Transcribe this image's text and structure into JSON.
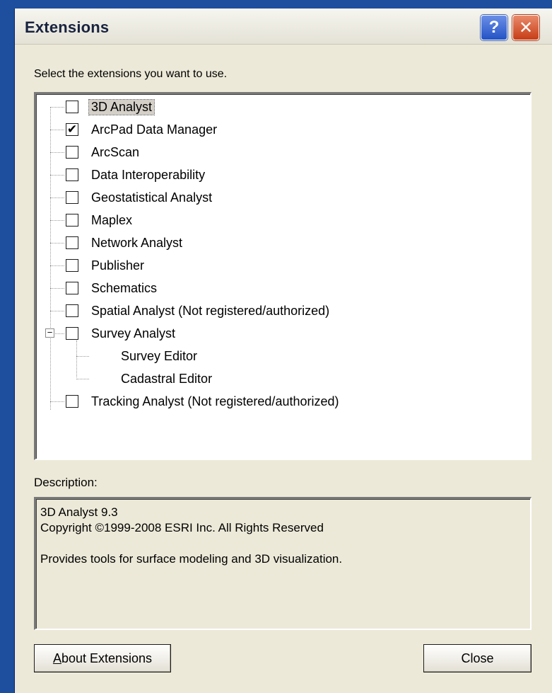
{
  "window": {
    "title": "Extensions",
    "help_glyph": "?",
    "close_glyph": "✕"
  },
  "prompt": "Select the extensions you want to use.",
  "extensions": [
    {
      "label": "3D Analyst",
      "checked": false,
      "selected": true
    },
    {
      "label": "ArcPad Data Manager",
      "checked": true
    },
    {
      "label": "ArcScan",
      "checked": false
    },
    {
      "label": "Data Interoperability",
      "checked": false
    },
    {
      "label": "Geostatistical Analyst",
      "checked": false
    },
    {
      "label": "Maplex",
      "checked": false
    },
    {
      "label": "Network Analyst",
      "checked": false
    },
    {
      "label": "Publisher",
      "checked": false
    },
    {
      "label": "Schematics",
      "checked": false
    },
    {
      "label": "Spatial Analyst (Not registered/authorized)",
      "checked": false
    },
    {
      "label": "Survey Analyst",
      "checked": false,
      "expanded": true,
      "children": [
        "Survey Editor",
        "Cadastral Editor"
      ]
    },
    {
      "label": "Tracking Analyst (Not registered/authorized)",
      "checked": false
    }
  ],
  "description": {
    "label": "Description:",
    "line1": "3D Analyst 9.3",
    "line2": "Copyright ©1999-2008 ESRI Inc. All Rights Reserved",
    "line3": "Provides tools for surface modeling and 3D visualization."
  },
  "buttons": {
    "about_accel": "A",
    "about_rest": "bout Extensions",
    "close": "Close"
  },
  "symbols": {
    "check": "✔",
    "collapse": "−"
  }
}
